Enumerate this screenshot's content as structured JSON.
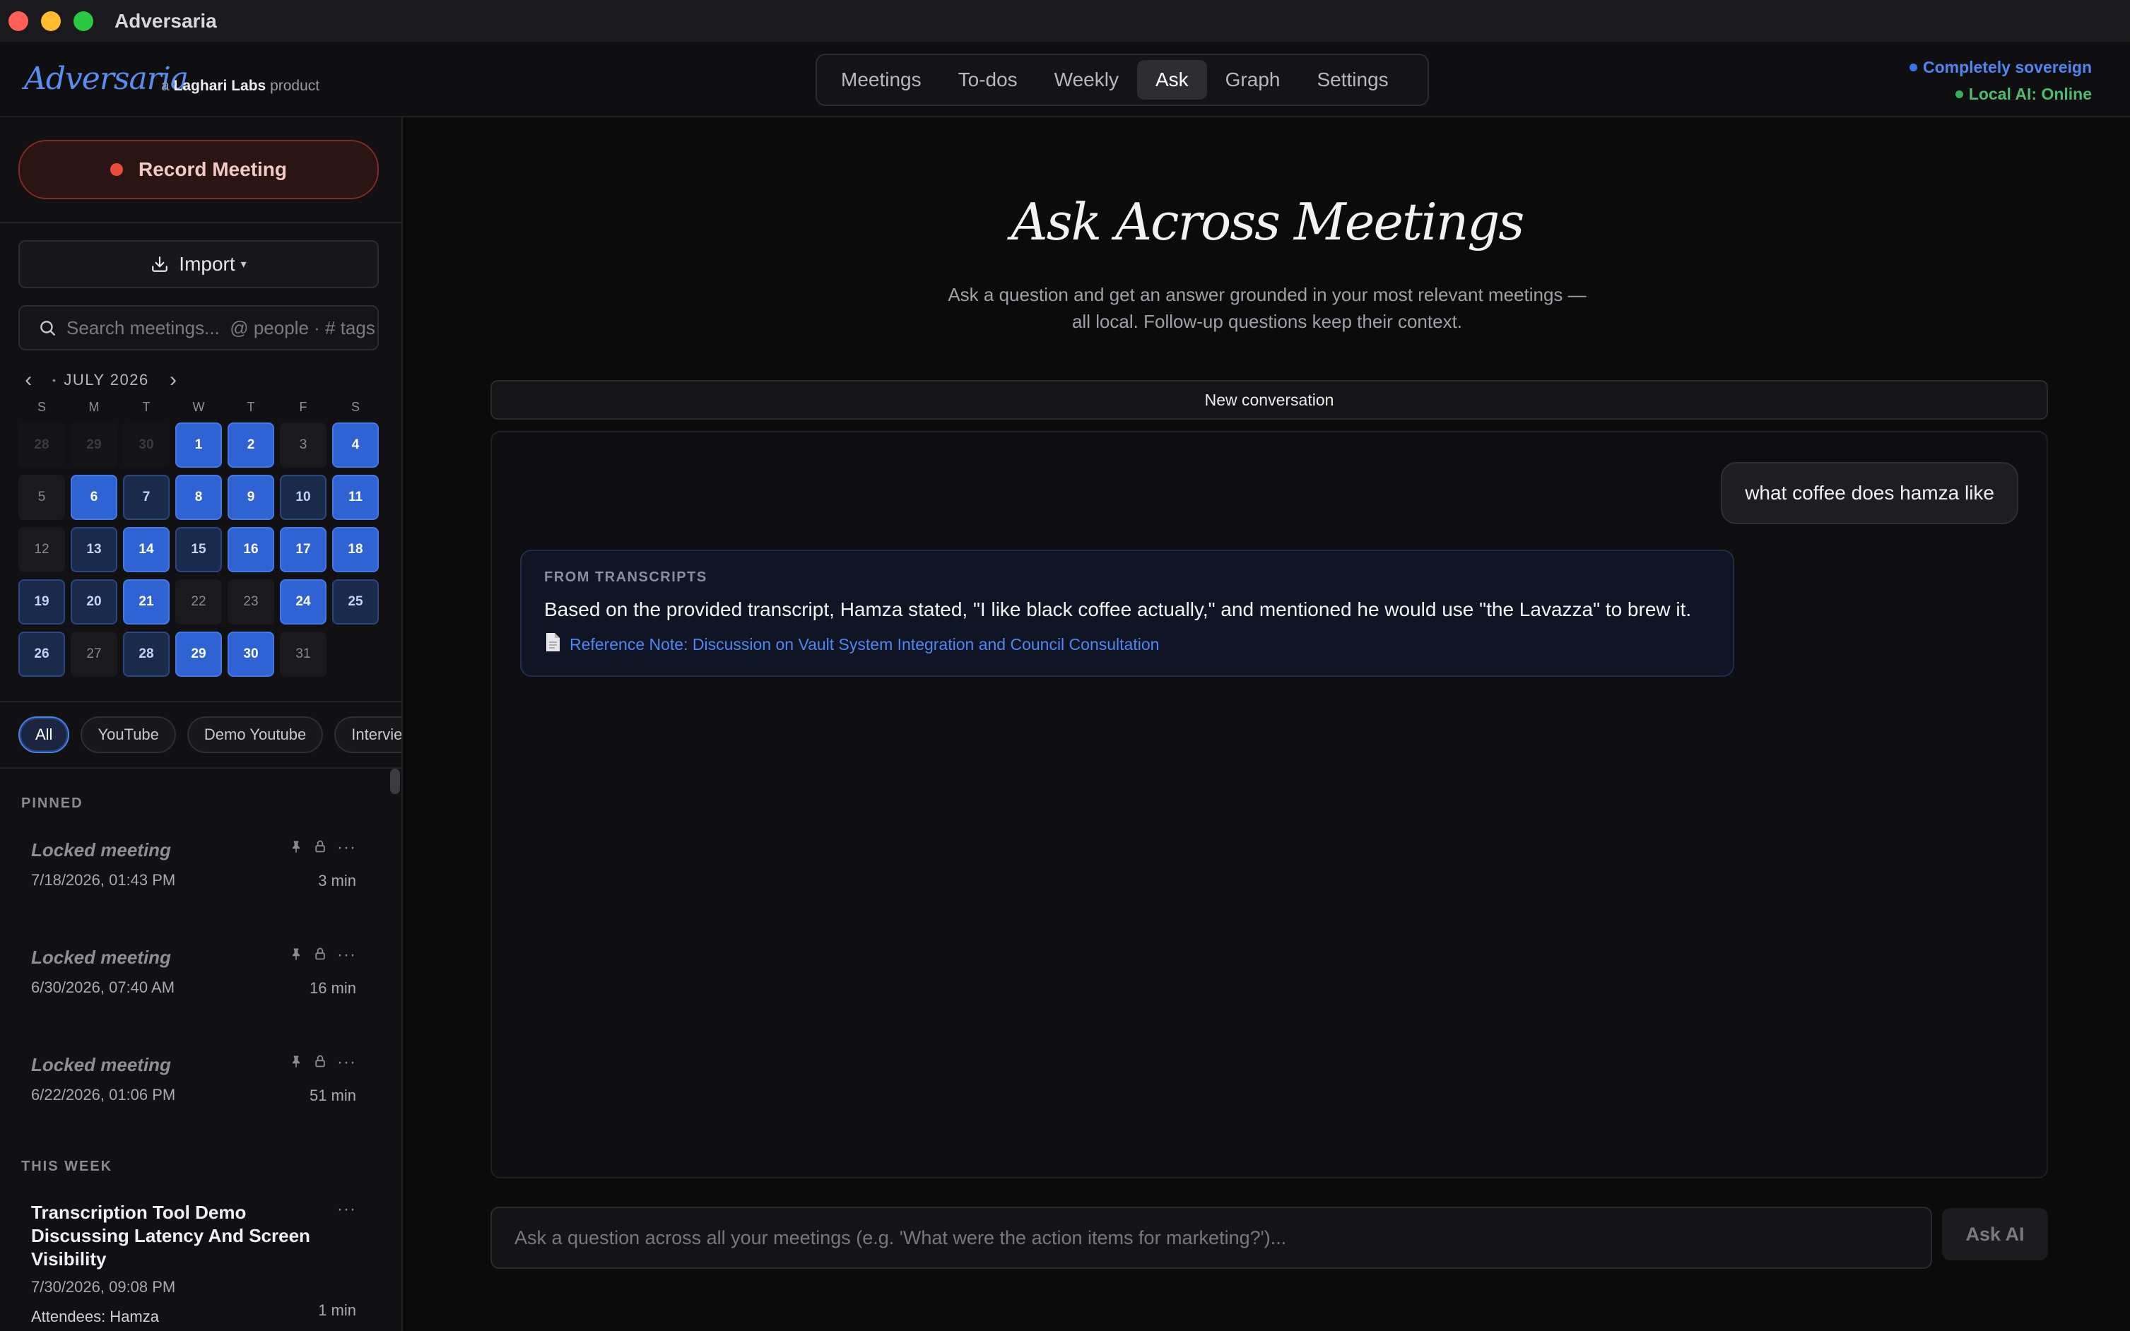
{
  "window": {
    "title": "Adversaria"
  },
  "header": {
    "brand": "Adversaria",
    "brand_prefix": "a",
    "brand_company": "Laghari Labs",
    "brand_suffix": "product",
    "tabs": [
      {
        "label": "Meetings",
        "active": false
      },
      {
        "label": "To-dos",
        "active": false
      },
      {
        "label": "Weekly",
        "active": false
      },
      {
        "label": "Ask",
        "active": true
      },
      {
        "label": "Graph",
        "active": false
      },
      {
        "label": "Settings",
        "active": false
      }
    ],
    "status": [
      {
        "label": "Completely sovereign",
        "color": "#3a74ea"
      },
      {
        "label": "Local AI: Online",
        "color": "#3aae5c"
      }
    ]
  },
  "sidebar": {
    "record_label": "Record Meeting",
    "import_label": "Import",
    "search_placeholder": "Search meetings...  @ people · # tags",
    "calendar": {
      "month_label": "JULY 2026",
      "prev_icon": "chevron-left",
      "next_icon": "chevron-right",
      "weekdays": [
        "S",
        "M",
        "T",
        "W",
        "T",
        "F",
        "S"
      ],
      "weeks": [
        [
          {
            "d": "28",
            "s": "out"
          },
          {
            "d": "29",
            "s": "out"
          },
          {
            "d": "30",
            "s": "out"
          },
          {
            "d": "1",
            "s": "hi"
          },
          {
            "d": "2",
            "s": "hi"
          },
          {
            "d": "3",
            "s": "none"
          },
          {
            "d": "4",
            "s": "hi"
          }
        ],
        [
          {
            "d": "5",
            "s": "none"
          },
          {
            "d": "6",
            "s": "hi"
          },
          {
            "d": "7",
            "s": "dim"
          },
          {
            "d": "8",
            "s": "hi"
          },
          {
            "d": "9",
            "s": "hi"
          },
          {
            "d": "10",
            "s": "dim"
          },
          {
            "d": "11",
            "s": "hi"
          }
        ],
        [
          {
            "d": "12",
            "s": "none"
          },
          {
            "d": "13",
            "s": "dim"
          },
          {
            "d": "14",
            "s": "hi"
          },
          {
            "d": "15",
            "s": "dim"
          },
          {
            "d": "16",
            "s": "hi"
          },
          {
            "d": "17",
            "s": "hi"
          },
          {
            "d": "18",
            "s": "hi"
          }
        ],
        [
          {
            "d": "19",
            "s": "dim"
          },
          {
            "d": "20",
            "s": "dim"
          },
          {
            "d": "21",
            "s": "hi"
          },
          {
            "d": "22",
            "s": "none"
          },
          {
            "d": "23",
            "s": "none"
          },
          {
            "d": "24",
            "s": "hi"
          },
          {
            "d": "25",
            "s": "dim"
          }
        ],
        [
          {
            "d": "26",
            "s": "dim"
          },
          {
            "d": "27",
            "s": "none"
          },
          {
            "d": "28",
            "s": "dim"
          },
          {
            "d": "29",
            "s": "hi"
          },
          {
            "d": "30",
            "s": "hi"
          },
          {
            "d": "31",
            "s": "none"
          }
        ]
      ]
    },
    "filters": [
      "All",
      "YouTube",
      "Demo Youtube",
      "Interviews"
    ],
    "active_filter": "All",
    "pinned_label": "PINNED",
    "pinned": [
      {
        "title": "Locked meeting",
        "date": "7/18/2026, 01:43 PM",
        "duration": "3 min"
      },
      {
        "title": "Locked meeting",
        "date": "6/30/2026, 07:40 AM",
        "duration": "16 min"
      },
      {
        "title": "Locked meeting",
        "date": "6/22/2026, 01:06 PM",
        "duration": "51 min"
      }
    ],
    "this_week_label": "THIS WEEK",
    "this_week": [
      {
        "title": "Transcription Tool Demo Discussing Latency And Screen Visibility",
        "date": "7/30/2026, 09:08 PM",
        "duration": "1 min",
        "attendees": "Attendees: Hamza"
      }
    ]
  },
  "main": {
    "title": "Ask Across Meetings",
    "subtitle_line1": "Ask a question and get an answer grounded in your most relevant meetings —",
    "subtitle_line2": "all local. Follow-up questions keep their context.",
    "new_conversation_label": "New conversation",
    "user_message": "what coffee does hamza like",
    "answer": {
      "source_label": "FROM TRANSCRIPTS",
      "text": "Based on the provided transcript, Hamza stated, \"I like black coffee actually,\" and mentioned he would use \"the Lavazza\" to brew it.",
      "reference": "Reference Note: Discussion on Vault System Integration and Council Consultation"
    },
    "input_placeholder": "Ask a question across all your meetings (e.g. 'What were the action items for marketing?')...",
    "ask_button": "Ask AI"
  }
}
